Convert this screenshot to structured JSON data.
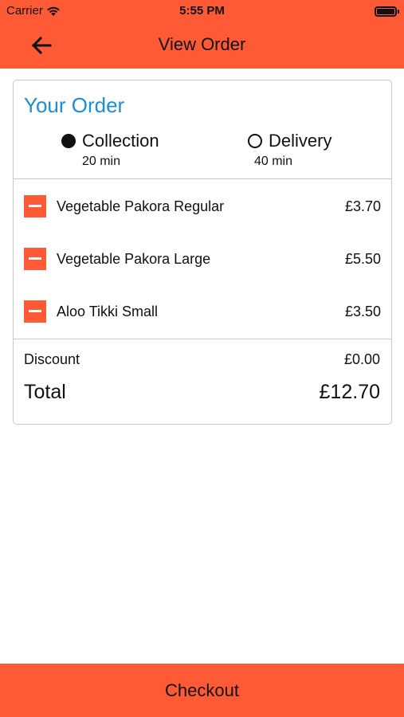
{
  "status_bar": {
    "carrier": "Carrier",
    "time": "5:55 PM"
  },
  "nav": {
    "title": "View Order"
  },
  "order": {
    "heading": "Your Order",
    "options": [
      {
        "label": "Collection",
        "time": "20 min",
        "selected": true
      },
      {
        "label": "Delivery",
        "time": "40 min",
        "selected": false
      }
    ],
    "items": [
      {
        "name": "Vegetable Pakora Regular",
        "price": "£3.70"
      },
      {
        "name": "Vegetable Pakora Large",
        "price": "£5.50"
      },
      {
        "name": "Aloo Tikki Small",
        "price": "£3.50"
      }
    ],
    "discount_label": "Discount",
    "discount_value": "£0.00",
    "total_label": "Total",
    "total_value": "£12.70"
  },
  "footer": {
    "checkout_label": "Checkout"
  },
  "colors": {
    "accent": "#ff5a36",
    "heading_blue": "#1a8fd6",
    "card_border": "#c8c8c8"
  }
}
